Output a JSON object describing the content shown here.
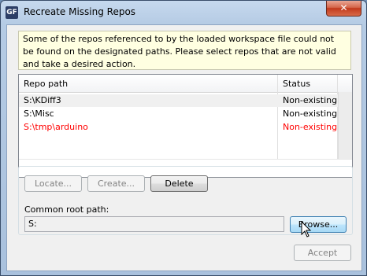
{
  "window": {
    "title": "Recreate Missing Repos",
    "icon_text": "GF",
    "close_glyph": "✕"
  },
  "info_text": "Some of the repos referenced to by the loaded workspace file could not be found on the designated paths. Please select repos that are not valid and take a desired action.",
  "table": {
    "columns": [
      "Repo path",
      "Status"
    ],
    "rows": [
      {
        "path": "S:\\KDiff3",
        "status": "Non-existing",
        "highlight": false
      },
      {
        "path": "S:\\Misc",
        "status": "Non-existing",
        "highlight": false
      },
      {
        "path": "S:\\tmp\\arduino",
        "status": "Non-existing",
        "highlight": true
      }
    ]
  },
  "buttons": {
    "locate": "Locate...",
    "create": "Create...",
    "delete": "Delete",
    "browse": "Browse...",
    "accept": "Accept"
  },
  "common_root": {
    "label": "Common root path:",
    "value": "S:"
  },
  "colors": {
    "highlight": "#ff0000",
    "selected_row": "#f0f0f0"
  }
}
